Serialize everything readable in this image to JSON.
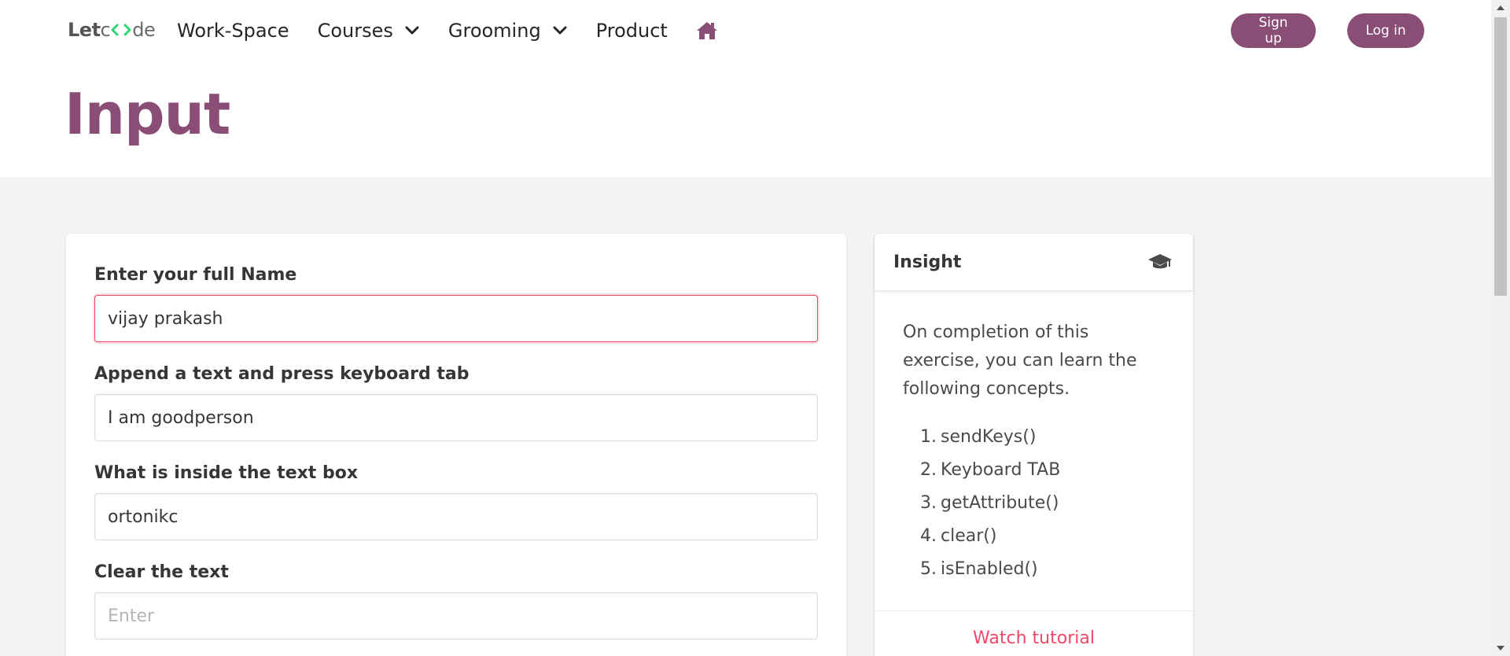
{
  "navbar": {
    "brand": {
      "part1": "Let",
      "part2": "de",
      "logo_icon": "code-brackets-logo-icon",
      "logo_color": "#2ed573"
    },
    "items": [
      {
        "label": "Work-Space"
      },
      {
        "label": "Courses",
        "icon": "chevron-down-icon"
      },
      {
        "label": "Grooming",
        "icon": "chevron-down-icon"
      },
      {
        "label": "Product"
      }
    ],
    "home_icon": "home-icon",
    "signup_label": "Sign up",
    "login_label": "Log in"
  },
  "hero": {
    "title": "Input"
  },
  "form": {
    "fields": [
      {
        "label": "Enter your full Name",
        "value": "vijay prakash",
        "placeholder": ""
      },
      {
        "label": "Append a text and press keyboard tab",
        "value": "I am goodperson",
        "placeholder": ""
      },
      {
        "label": "What is inside the text box",
        "value": "ortonikc",
        "placeholder": ""
      },
      {
        "label": "Clear the text",
        "value": "",
        "placeholder": "Enter"
      }
    ]
  },
  "insight": {
    "title": "Insight",
    "icon": "graduation-cap-icon",
    "text": "On completion of this exercise, you can learn the following concepts.",
    "items": [
      {
        "num": "1.",
        "label": "sendKeys()"
      },
      {
        "num": "2.",
        "label": "Keyboard TAB"
      },
      {
        "num": "3.",
        "label": "getAttribute()"
      },
      {
        "num": "4.",
        "label": "clear()"
      },
      {
        "num": "5.",
        "label": "isEnabled()"
      }
    ],
    "footer_link": "Watch tutorial"
  },
  "colors": {
    "brand": "#8a4d76",
    "focus_border": "#f14668",
    "link": "#f14668"
  }
}
